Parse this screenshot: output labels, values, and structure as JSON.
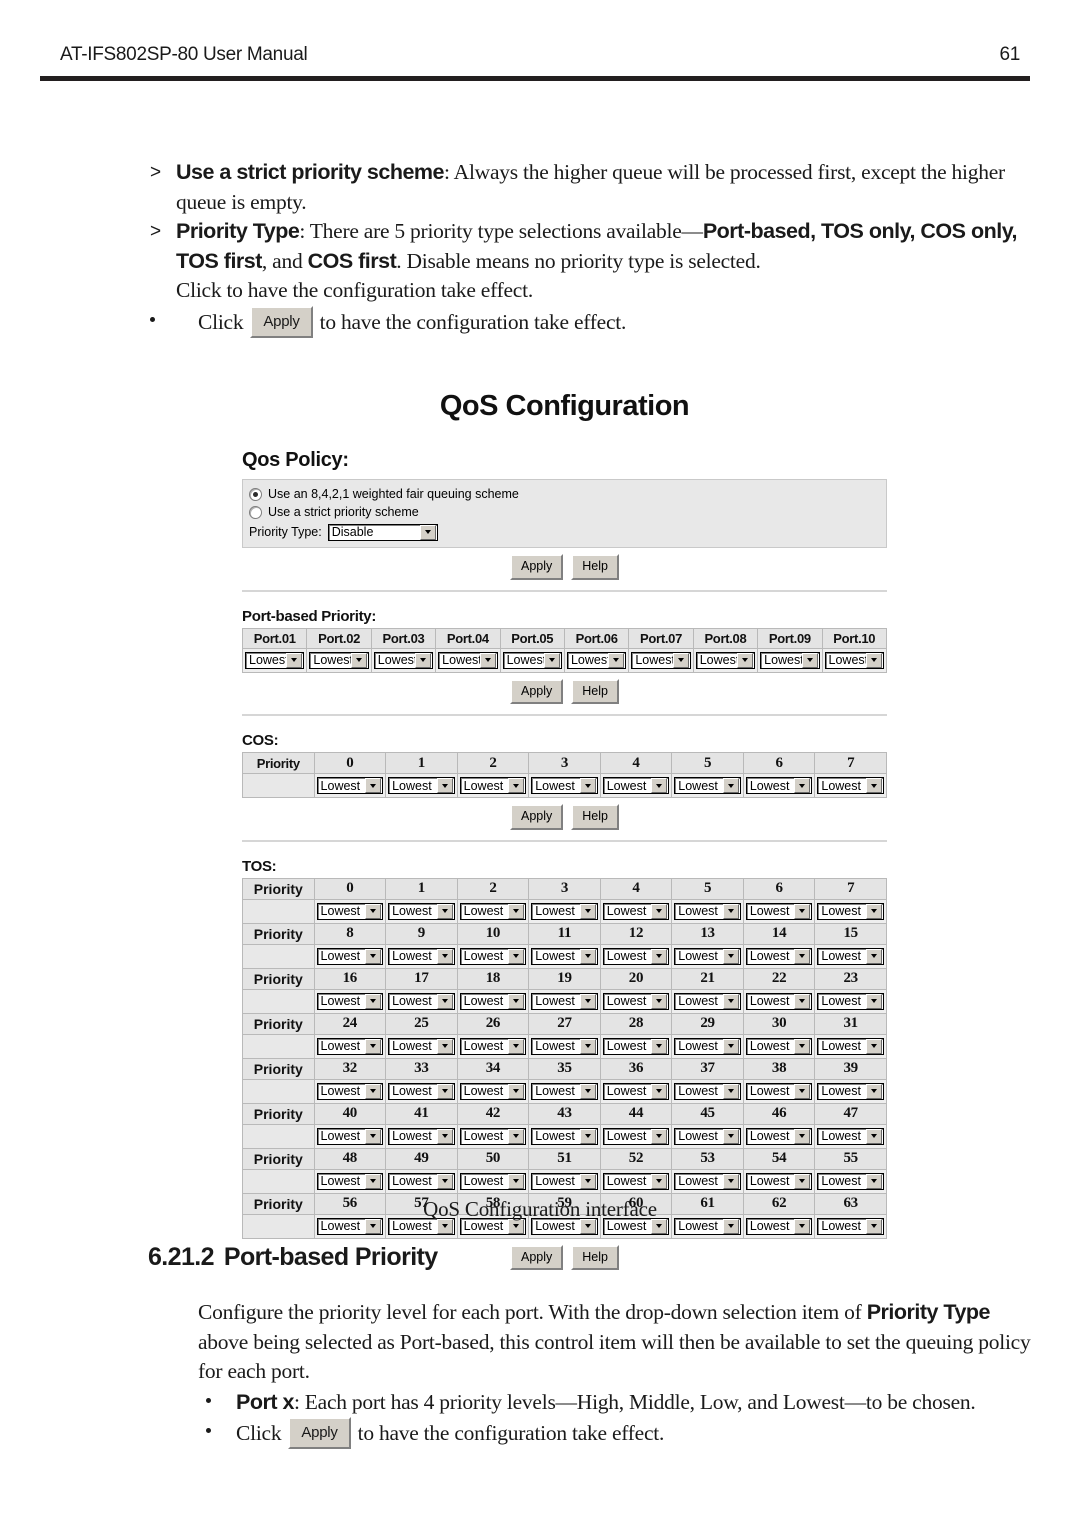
{
  "header": {
    "manual_title": "AT-IFS802SP-80 User Manual",
    "page_number": "61"
  },
  "intro": {
    "bullet1_marker": ">",
    "bullet1_term": "Use a strict priority scheme",
    "bullet1_text": ": Always the higher queue will be processed first, except the higher queue is empty.",
    "bullet2_marker": ">",
    "bullet2_term": "Priority Type",
    "bullet2_part1": ": There are 5 priority type selections available—",
    "bullet2_opt1": "Port-based, TOS only, COS only, TOS first",
    "bullet2_mid": ", and ",
    "bullet2_opt2": "COS first",
    "bullet2_part2": ". Disable means no priority type is selected.",
    "orphan_click": "Click   to have the configuration take effect.",
    "click_prefix": "Click",
    "apply_label": "Apply",
    "click_suffix": "to have the configuration take effect."
  },
  "figure": {
    "title": "QoS Configuration",
    "qos_policy": {
      "heading": "Qos Policy:",
      "option_wfq": "Use an 8,4,2,1 weighted fair queuing scheme",
      "option_strict": "Use a strict priority scheme",
      "wfq_selected": true,
      "strict_selected": false,
      "priority_type_label": "Priority Type:",
      "priority_type_value": "Disable",
      "apply_label": "Apply",
      "help_label": "Help"
    },
    "port_based": {
      "heading": "Port-based Priority:",
      "columns": [
        "Port.01",
        "Port.02",
        "Port.03",
        "Port.04",
        "Port.05",
        "Port.06",
        "Port.07",
        "Port.08",
        "Port.09",
        "Port.10"
      ],
      "values": [
        "Lowest",
        "Lowest",
        "Lowest",
        "Lowest",
        "Lowest",
        "Lowest",
        "Lowest",
        "Lowest",
        "Lowest",
        "Lowest"
      ],
      "apply_label": "Apply",
      "help_label": "Help"
    },
    "cos": {
      "heading": "COS:",
      "row_label": "Priority",
      "columns": [
        "0",
        "1",
        "2",
        "3",
        "4",
        "5",
        "6",
        "7"
      ],
      "values": [
        "Lowest",
        "Lowest",
        "Lowest",
        "Lowest",
        "Lowest",
        "Lowest",
        "Lowest",
        "Lowest"
      ],
      "apply_label": "Apply",
      "help_label": "Help"
    },
    "tos": {
      "heading": "TOS:",
      "row_label": "Priority",
      "rows": [
        {
          "numbers": [
            "0",
            "1",
            "2",
            "3",
            "4",
            "5",
            "6",
            "7"
          ],
          "values": [
            "Lowest",
            "Lowest",
            "Lowest",
            "Lowest",
            "Lowest",
            "Lowest",
            "Lowest",
            "Lowest"
          ]
        },
        {
          "numbers": [
            "8",
            "9",
            "10",
            "11",
            "12",
            "13",
            "14",
            "15"
          ],
          "values": [
            "Lowest",
            "Lowest",
            "Lowest",
            "Lowest",
            "Lowest",
            "Lowest",
            "Lowest",
            "Lowest"
          ]
        },
        {
          "numbers": [
            "16",
            "17",
            "18",
            "19",
            "20",
            "21",
            "22",
            "23"
          ],
          "values": [
            "Lowest",
            "Lowest",
            "Lowest",
            "Lowest",
            "Lowest",
            "Lowest",
            "Lowest",
            "Lowest"
          ]
        },
        {
          "numbers": [
            "24",
            "25",
            "26",
            "27",
            "28",
            "29",
            "30",
            "31"
          ],
          "values": [
            "Lowest",
            "Lowest",
            "Lowest",
            "Lowest",
            "Lowest",
            "Lowest",
            "Lowest",
            "Lowest"
          ]
        },
        {
          "numbers": [
            "32",
            "33",
            "34",
            "35",
            "36",
            "37",
            "38",
            "39"
          ],
          "values": [
            "Lowest",
            "Lowest",
            "Lowest",
            "Lowest",
            "Lowest",
            "Lowest",
            "Lowest",
            "Lowest"
          ]
        },
        {
          "numbers": [
            "40",
            "41",
            "42",
            "43",
            "44",
            "45",
            "46",
            "47"
          ],
          "values": [
            "Lowest",
            "Lowest",
            "Lowest",
            "Lowest",
            "Lowest",
            "Lowest",
            "Lowest",
            "Lowest"
          ]
        },
        {
          "numbers": [
            "48",
            "49",
            "50",
            "51",
            "52",
            "53",
            "54",
            "55"
          ],
          "values": [
            "Lowest",
            "Lowest",
            "Lowest",
            "Lowest",
            "Lowest",
            "Lowest",
            "Lowest",
            "Lowest"
          ]
        },
        {
          "numbers": [
            "56",
            "57",
            "58",
            "59",
            "60",
            "61",
            "62",
            "63"
          ],
          "values": [
            "Lowest",
            "Lowest",
            "Lowest",
            "Lowest",
            "Lowest",
            "Lowest",
            "Lowest",
            "Lowest"
          ]
        }
      ],
      "apply_label": "Apply",
      "help_label": "Help"
    },
    "caption": "QoS Configuration interface"
  },
  "section": {
    "number": "6.21.2",
    "title": "Port-based Priority",
    "para_part1": "Configure the priority level for each port. With the drop-down selection item of ",
    "para_bold1": "Priority Type",
    "para_part2": " above being selected as Port-based, this control item will then be available to set the queuing policy for each port.",
    "bullet_port_term": "Port x",
    "bullet_port_text": ": Each port has 4 priority levels—High, Middle, Low, and Lowest—to be chosen.",
    "click_prefix": "Click",
    "apply_label": "Apply",
    "click_suffix": "to have the configuration take effect."
  },
  "colors": {
    "panel_bg": "#e8e8e8",
    "header_cell_bg": "#e4e4e4",
    "button_face": "#d4d0c8",
    "rule": "#231f20"
  }
}
